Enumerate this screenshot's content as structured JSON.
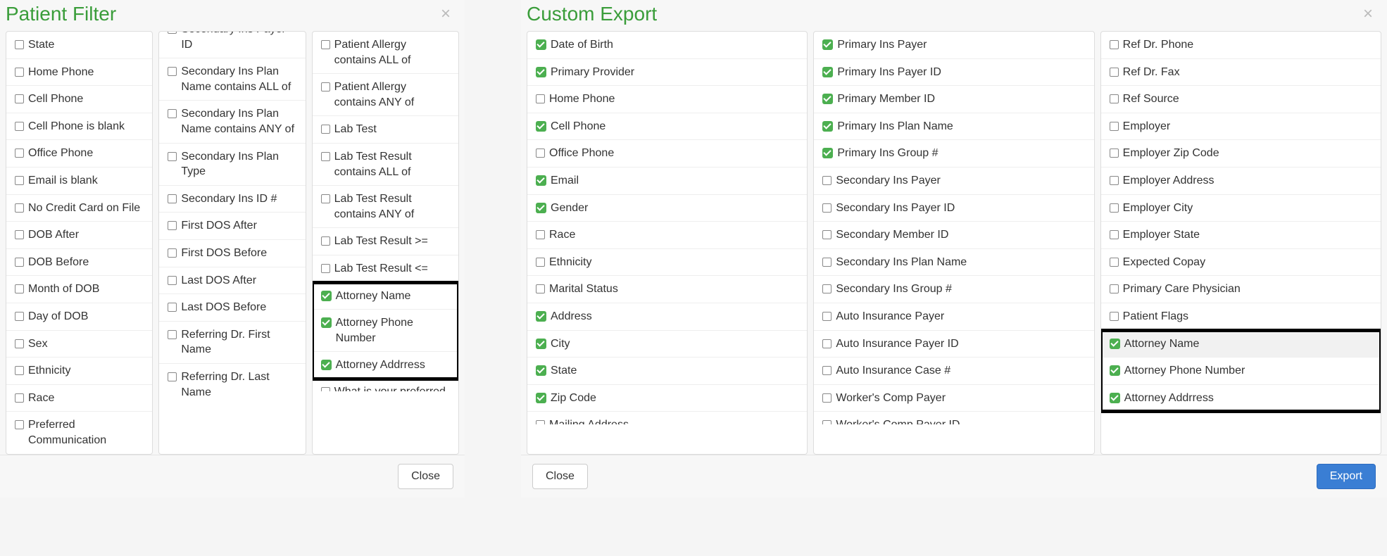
{
  "patientFilter": {
    "title": "Patient Filter",
    "closeBtn": "Close",
    "col1": [
      {
        "label": "State",
        "checked": false
      },
      {
        "label": "Home Phone",
        "checked": false
      },
      {
        "label": "Cell Phone",
        "checked": false
      },
      {
        "label": "Cell Phone is blank",
        "checked": false
      },
      {
        "label": "Office Phone",
        "checked": false
      },
      {
        "label": "Email is blank",
        "checked": false
      },
      {
        "label": "No Credit Card on File",
        "checked": false
      },
      {
        "label": "DOB After",
        "checked": false
      },
      {
        "label": "DOB Before",
        "checked": false
      },
      {
        "label": "Month of DOB",
        "checked": false
      },
      {
        "label": "Day of DOB",
        "checked": false
      },
      {
        "label": "Sex",
        "checked": false
      },
      {
        "label": "Ethnicity",
        "checked": false
      },
      {
        "label": "Race",
        "checked": false
      },
      {
        "label": "Preferred Communication",
        "checked": false
      }
    ],
    "col2": [
      {
        "label": "Secondary Ins Payer ID",
        "checked": false,
        "cutTop": true
      },
      {
        "label": "Secondary Ins Plan Name contains ALL of",
        "checked": false
      },
      {
        "label": "Secondary Ins Plan Name contains ANY of",
        "checked": false
      },
      {
        "label": "Secondary Ins Plan Type",
        "checked": false
      },
      {
        "label": "Secondary Ins ID #",
        "checked": false
      },
      {
        "label": "First DOS After",
        "checked": false
      },
      {
        "label": "First DOS Before",
        "checked": false
      },
      {
        "label": "Last DOS After",
        "checked": false
      },
      {
        "label": "Last DOS Before",
        "checked": false
      },
      {
        "label": "Referring Dr. First Name",
        "checked": false
      },
      {
        "label": "Referring Dr. Last Name",
        "checked": false
      }
    ],
    "col3": [
      {
        "label": "Patient Allergy contains ALL of",
        "checked": false
      },
      {
        "label": "Patient Allergy contains ANY of",
        "checked": false
      },
      {
        "label": "Lab Test",
        "checked": false
      },
      {
        "label": "Lab Test Result contains ALL of",
        "checked": false
      },
      {
        "label": "Lab Test Result contains ANY of",
        "checked": false
      },
      {
        "label": "Lab Test Result >=",
        "checked": false
      },
      {
        "label": "Lab Test Result <=",
        "checked": false
      },
      {
        "label": "Attorney Name",
        "checked": true,
        "hl": "start"
      },
      {
        "label": "Attorney Phone Number",
        "checked": true,
        "hl": "mid"
      },
      {
        "label": "Attorney Addrress",
        "checked": true,
        "hl": "end"
      },
      {
        "label": "What is your preferred",
        "checked": false,
        "cutBottom": true
      }
    ]
  },
  "customExport": {
    "title": "Custom Export",
    "closeBtn": "Close",
    "exportBtn": "Export",
    "col1": [
      {
        "label": "Date of Birth",
        "checked": true
      },
      {
        "label": "Primary Provider",
        "checked": true
      },
      {
        "label": "Home Phone",
        "checked": false
      },
      {
        "label": "Cell Phone",
        "checked": true
      },
      {
        "label": "Office Phone",
        "checked": false
      },
      {
        "label": "Email",
        "checked": true
      },
      {
        "label": "Gender",
        "checked": true
      },
      {
        "label": "Race",
        "checked": false
      },
      {
        "label": "Ethnicity",
        "checked": false
      },
      {
        "label": "Marital Status",
        "checked": false
      },
      {
        "label": "Address",
        "checked": true
      },
      {
        "label": "City",
        "checked": true
      },
      {
        "label": "State",
        "checked": true
      },
      {
        "label": "Zip Code",
        "checked": true
      },
      {
        "label": "Mailing Address",
        "checked": false,
        "cutBottom": true
      }
    ],
    "col2": [
      {
        "label": "Primary Ins Payer",
        "checked": true
      },
      {
        "label": "Primary Ins Payer ID",
        "checked": true
      },
      {
        "label": "Primary Member ID",
        "checked": true
      },
      {
        "label": "Primary Ins Plan Name",
        "checked": true
      },
      {
        "label": "Primary Ins Group #",
        "checked": true
      },
      {
        "label": "Secondary Ins Payer",
        "checked": false
      },
      {
        "label": "Secondary Ins Payer ID",
        "checked": false
      },
      {
        "label": "Secondary Member ID",
        "checked": false
      },
      {
        "label": "Secondary Ins Plan Name",
        "checked": false
      },
      {
        "label": "Secondary Ins Group #",
        "checked": false
      },
      {
        "label": "Auto Insurance Payer",
        "checked": false
      },
      {
        "label": "Auto Insurance Payer ID",
        "checked": false
      },
      {
        "label": "Auto Insurance Case #",
        "checked": false
      },
      {
        "label": "Worker's Comp Payer",
        "checked": false
      },
      {
        "label": "Worker's Comp Payer ID",
        "checked": false,
        "cutBottom": true
      }
    ],
    "col3": [
      {
        "label": "Ref Dr. Phone",
        "checked": false
      },
      {
        "label": "Ref Dr. Fax",
        "checked": false
      },
      {
        "label": "Ref Source",
        "checked": false
      },
      {
        "label": "Employer",
        "checked": false
      },
      {
        "label": "Employer Zip Code",
        "checked": false
      },
      {
        "label": "Employer Address",
        "checked": false
      },
      {
        "label": "Employer City",
        "checked": false
      },
      {
        "label": "Employer State",
        "checked": false
      },
      {
        "label": "Expected Copay",
        "checked": false
      },
      {
        "label": "Primary Care Physician",
        "checked": false
      },
      {
        "label": "Patient Flags",
        "checked": false
      },
      {
        "label": "Attorney Name",
        "checked": true,
        "hl": "start",
        "hlRow": true
      },
      {
        "label": "Attorney Phone Number",
        "checked": true,
        "hl": "mid"
      },
      {
        "label": "Attorney Addrress",
        "checked": true,
        "hl": "end"
      }
    ]
  }
}
